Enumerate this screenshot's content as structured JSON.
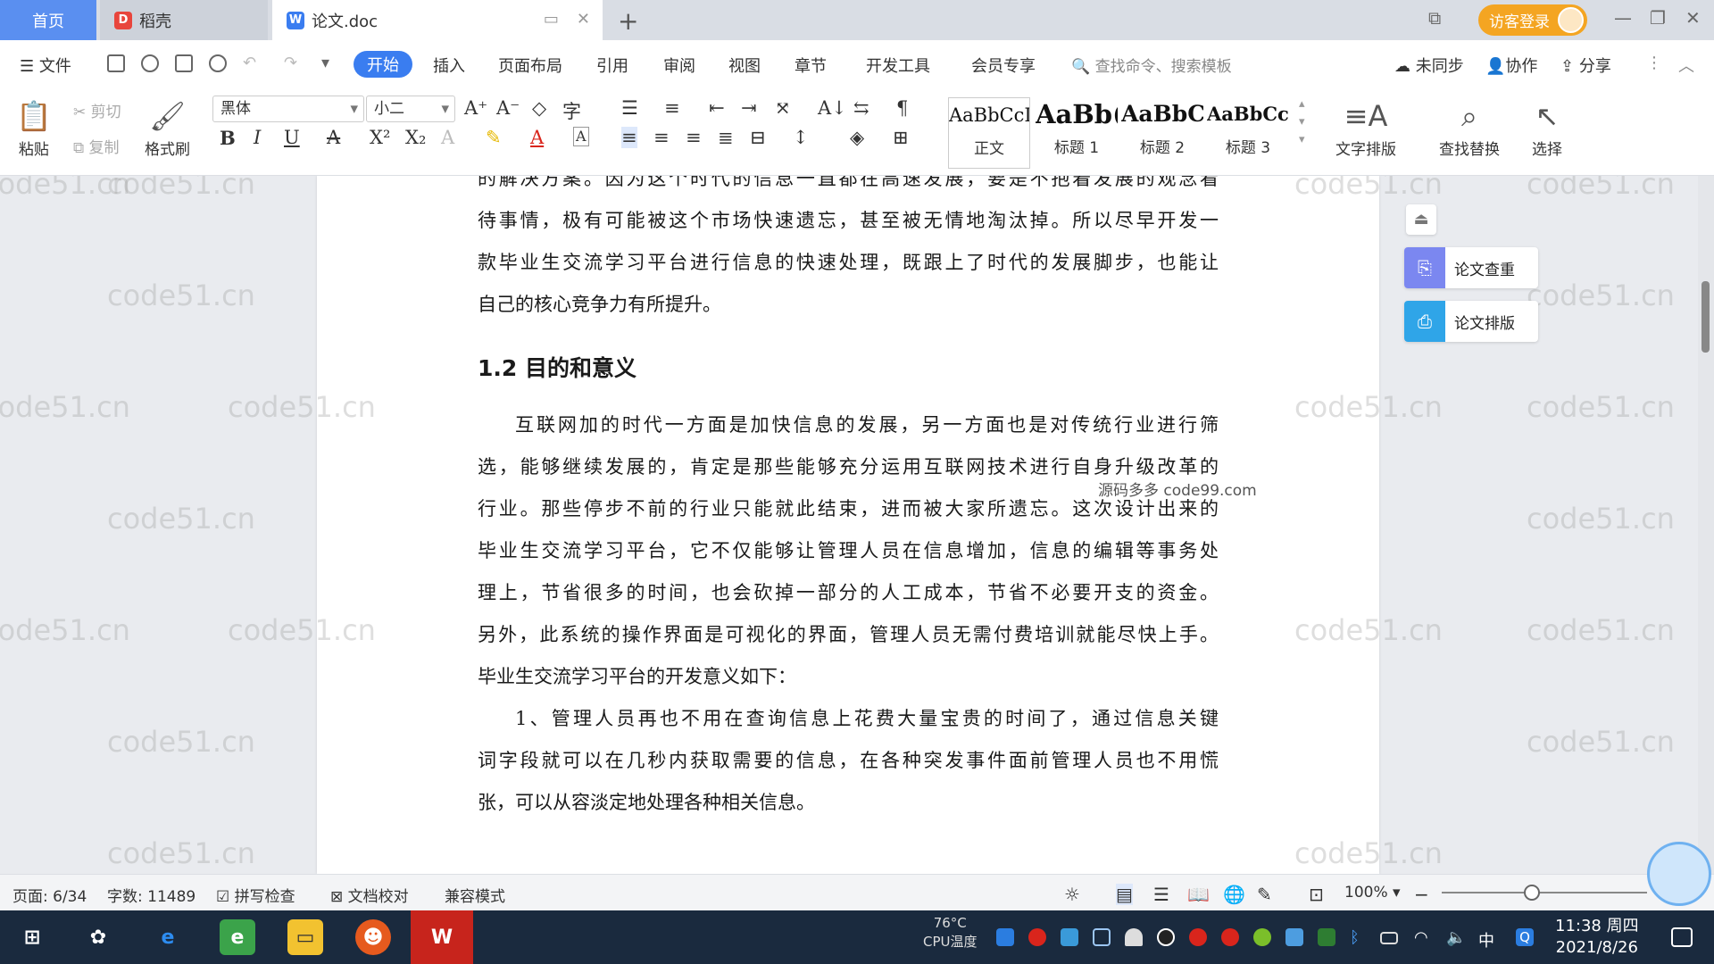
{
  "titlebar": {
    "tab_home": "首页",
    "tab_daoke": "稻壳",
    "tab_doc": "论文.doc",
    "login": "访客登录"
  },
  "menubar": {
    "file": "文件",
    "items": [
      "开始",
      "插入",
      "页面布局",
      "引用",
      "审阅",
      "视图",
      "章节",
      "开发工具",
      "会员专享"
    ],
    "search_placeholder": "查找命令、搜索模板",
    "sync": "未同步",
    "collab": "协作",
    "share": "分享"
  },
  "ribbon": {
    "paste": "粘贴",
    "cut": "剪切",
    "copy": "复制",
    "format_painter": "格式刷",
    "font_name": "黑体",
    "font_size": "小二",
    "styles": [
      {
        "preview": "AaBbCcI",
        "name": "正文"
      },
      {
        "preview": "AaBb(",
        "name": "标题 1"
      },
      {
        "preview": "AaBbC",
        "name": "标题 2"
      },
      {
        "preview": "AaBbCcl",
        "name": "标题 3"
      }
    ],
    "text_layout": "文字排版",
    "find_replace": "查找替换",
    "select": "选择"
  },
  "document": {
    "lines_top": [
      "的解决方案。因为这个时代的信息一直都在高速发展，要是不抱着发展的观念看",
      "待事情，极有可能被这个市场快速遗忘，甚至被无情地淘汰掉。所以尽早开发一",
      "款毕业生交流学习平台进行信息的快速处理，既跟上了时代的发展脚步，也能让",
      "自己的核心竞争力有所提升。"
    ],
    "heading": "1.2 目的和意义",
    "para1": [
      "互联网加的时代一方面是加快信息的发展，另一方面也是对传统行业进行筛",
      "选，能够继续发展的，肯定是那些能够充分运用互联网技术进行自身升级改革的",
      "行业。那些停步不前的行业只能就此结束，进而被大家所遗忘。这次设计出来的",
      "毕业生交流学习平台，它不仅能够让管理人员在信息增加，信息的编辑等事务处",
      "理上，节省很多的时间，也会砍掉一部分的人工成本，节省不必要开支的资金。",
      "另外，此系统的操作界面是可视化的界面，管理人员无需付费培训就能尽快上手。",
      "毕业生交流学习平台的开发意义如下："
    ],
    "para2": [
      "1、管理人员再也不用在查询信息上花费大量宝贵的时间了，通过信息关键",
      "词字段就可以在几秒内获取需要的信息，在各种突发事件面前管理人员也不用慌",
      "张，可以从容淡定地处理各种相关信息。"
    ],
    "overlay": "源码多多 code99.com",
    "watermark": "code51.cn"
  },
  "sidepanel": {
    "check": "论文查重",
    "layout": "论文排版"
  },
  "statusbar": {
    "page": "页面: 6/34",
    "words": "字数: 11489",
    "spell": "拼写检查",
    "proof": "文档校对",
    "compat": "兼容模式",
    "zoom": "100%"
  },
  "taskbar": {
    "cpu_temp": "76°C",
    "cpu_label": "CPU温度",
    "time": "11:38 周四",
    "date": "2021/8/26",
    "ime": "中"
  },
  "colors": {
    "accent": "#3a7df0",
    "home_tab": "#5a8ff0",
    "login": "#f4a522",
    "taskbar": "#1a2a3e"
  }
}
